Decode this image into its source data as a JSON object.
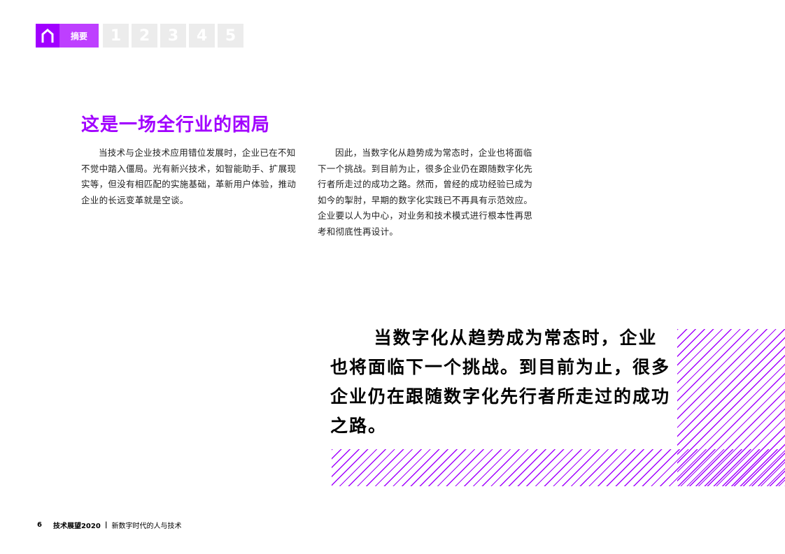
{
  "nav": {
    "summary_label": "摘要",
    "pages": [
      "1",
      "2",
      "3",
      "4",
      "5"
    ]
  },
  "section": {
    "title": "这是一场全行业的困局",
    "paragraphs": [
      "当技术与企业技术应用错位发展时，企业已在不知不觉中踏入僵局。光有新兴技术，如智能助手、扩展现实等，但没有相匹配的实施基础，革新用户体验，推动企业的长远变革就是空谈。",
      "因此，当数字化从趋势成为常态时，企业也将面临下一个挑战。到目前为止，很多企业仍在跟随数字化先行者所走过的成功之路。然而，曾经的成功经验已成为如今的掣肘，早期的数字化实践已不再具有示范效应。企业要以人为中心，对业务和技术模式进行根本性再思考和彻底性再设计。"
    ],
    "pull_quote": "当数字化从趋势成为常态时，企业也将面临下一个挑战。到目前为止，很多企业仍在跟随数字化先行者所走过的成功之路。"
  },
  "footer": {
    "page_number": "6",
    "title": "技术展望2020",
    "separator": "|",
    "subtitle": "新数字时代的人与技术"
  },
  "colors": {
    "accent": "#a100ff",
    "accent_light": "#be3fff",
    "nav_inactive": "#ececec"
  },
  "icons": {
    "home": "home-icon"
  }
}
